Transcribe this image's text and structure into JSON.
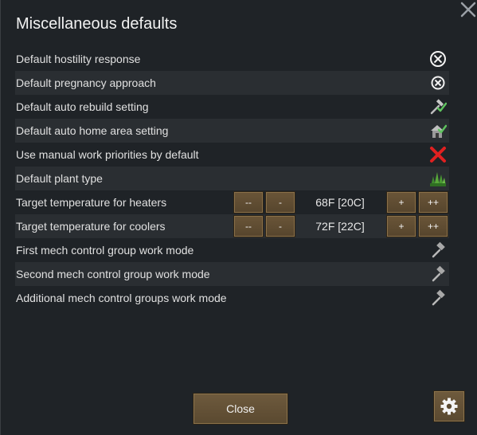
{
  "dialog": {
    "title": "Miscellaneous defaults",
    "close_icon": "close-x-icon"
  },
  "settings": [
    {
      "label": "Default hostility response",
      "icon": "hostility-response-icon"
    },
    {
      "label": "Default pregnancy approach",
      "icon": "pregnancy-approach-icon"
    },
    {
      "label": "Default auto rebuild setting",
      "icon": "auto-rebuild-checked-icon"
    },
    {
      "label": "Default auto home area setting",
      "icon": "home-area-checked-icon"
    },
    {
      "label": "Use manual work priorities by default",
      "icon": "red-cross-icon"
    },
    {
      "label": "Default plant type",
      "icon": "plant-icon"
    },
    {
      "label": "Target temperature for heaters"
    },
    {
      "label": "Target temperature for coolers"
    },
    {
      "label": "First mech control group work mode",
      "icon": "hammer-icon"
    },
    {
      "label": "Second mech control group work mode",
      "icon": "hammer-icon"
    },
    {
      "label": "Additional mech control groups work mode",
      "icon": "hammer-icon"
    }
  ],
  "temperature": {
    "heaters_value": "68F [20C]",
    "coolers_value": "72F [22C]",
    "dec_large": "--",
    "dec_small": "-",
    "inc_small": "+",
    "inc_large": "++"
  },
  "footer": {
    "close_label": "Close",
    "settings_icon": "gear-icon"
  },
  "colors": {
    "panel": "#1f2327",
    "row_alt": "#2a2e32",
    "button": "#62503a",
    "check_green": "#5fc35f",
    "cross_red": "#e02020"
  }
}
